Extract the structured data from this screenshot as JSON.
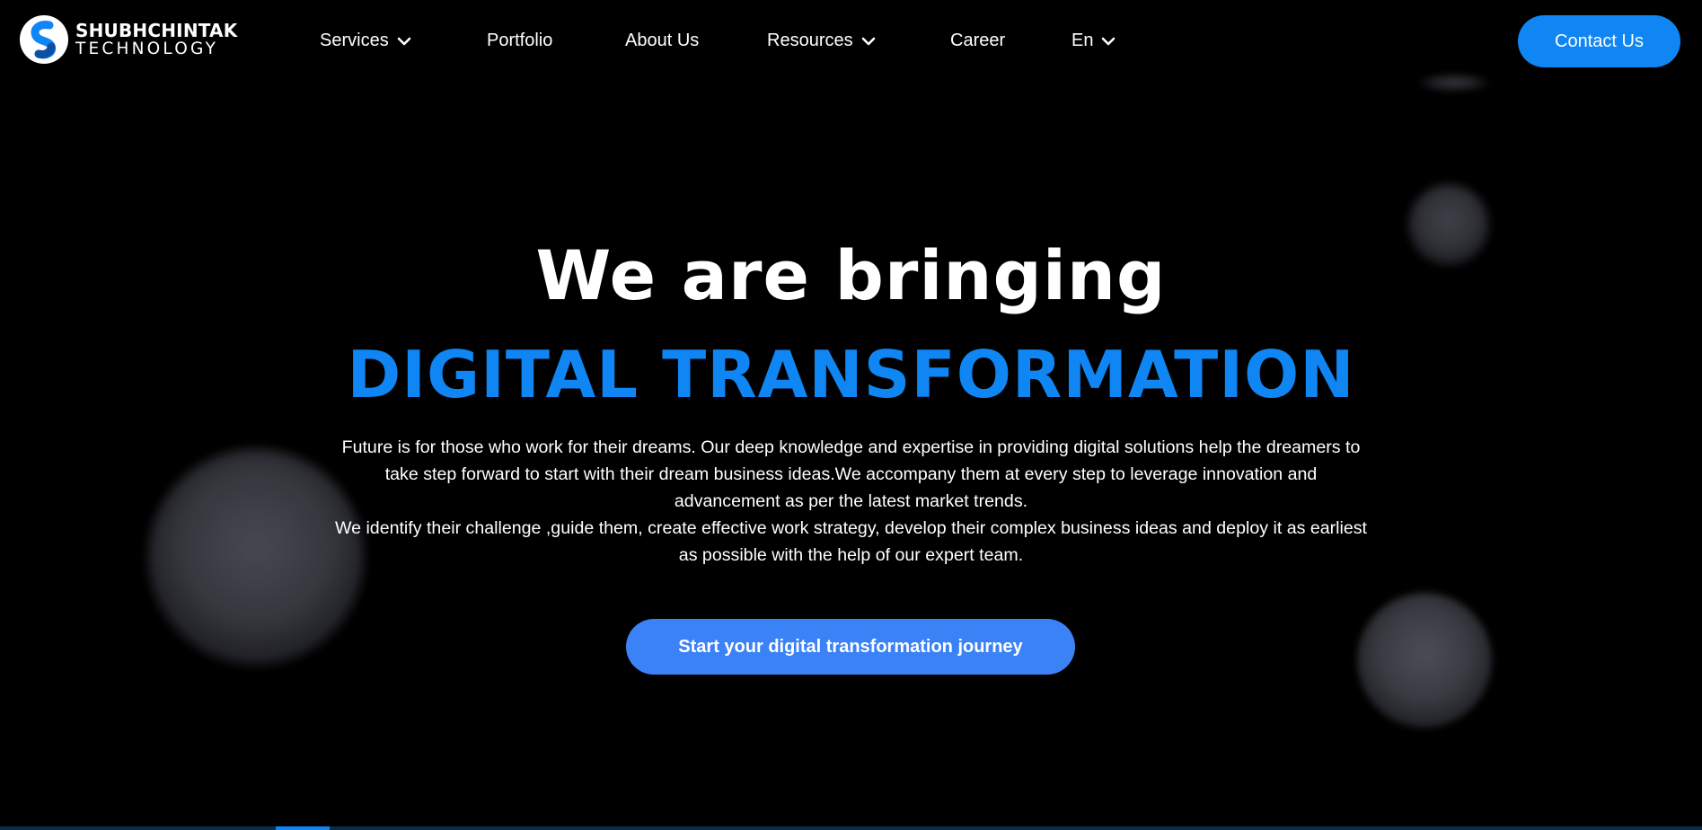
{
  "brand": {
    "name_top": "SHUBHCHINTAK",
    "name_bottom": "TECHNOLOGY",
    "logo_icon": "s-logo-icon",
    "accent_color": "#0f86f4"
  },
  "nav": {
    "items": [
      {
        "label": "Services",
        "has_dropdown": true
      },
      {
        "label": "Portfolio",
        "has_dropdown": false
      },
      {
        "label": "About Us",
        "has_dropdown": false
      },
      {
        "label": "Resources",
        "has_dropdown": true
      },
      {
        "label": "Career",
        "has_dropdown": false
      },
      {
        "label": "En",
        "has_dropdown": true
      }
    ],
    "dropdown_icon": "chevron-down-icon",
    "contact_label": "Contact Us"
  },
  "hero": {
    "headline": "We are bringing",
    "subheadline": "DIGITAL TRANSFORMATION",
    "paragraph_1": "Future is for those who work for their dreams. Our deep knowledge and expertise in providing digital solutions help the dreamers to take step forward to start with their dream business ideas.We accompany them at every step to leverage innovation and advancement as per the latest market trends.",
    "paragraph_2": "We identify their challenge ,guide them, create effective work strategy, develop their complex business ideas and deploy it as earliest as possible with the help of our expert team.",
    "cta_label": "Start your digital transformation journey",
    "cta_color": "#3b82f6"
  }
}
